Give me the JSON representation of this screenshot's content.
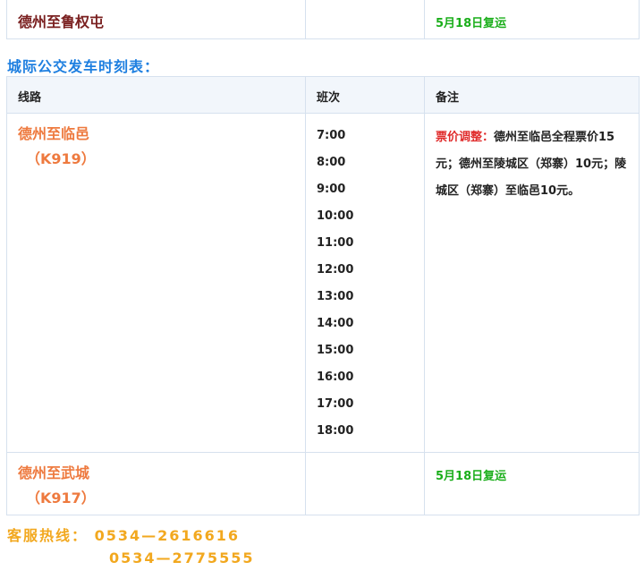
{
  "top_row": {
    "route": "德州至鲁权屯",
    "schedule": "",
    "note": "5月18日复运"
  },
  "section_heading": "城际公交发车时刻表：",
  "table": {
    "headers": {
      "route": "线路",
      "schedule": "班次",
      "note": "备注"
    },
    "row1": {
      "route_name": "德州至临邑",
      "route_code": "（K919）",
      "times": [
        "7:00",
        "8:00",
        "9:00",
        "10:00",
        "11:00",
        "12:00",
        "13:00",
        "14:00",
        "15:00",
        "16:00",
        "17:00",
        "18:00"
      ],
      "note_label": "票价调整：",
      "note_text": "德州至临邑全程票价15元；德州至陵城区（郑寨）10元；陵城区（郑寨）至临邑10元。"
    },
    "row2": {
      "route_name": "德州至武城",
      "route_code": "（K917）",
      "note": "5月18日复运"
    }
  },
  "hotline": {
    "label": "客服热线：",
    "phone1": "0534—2616616",
    "phone2": "0534—2775555"
  },
  "colors": {
    "heading_blue": "#1e7fe0",
    "route_orange": "#ee7a3f",
    "route_dark": "#7a2020",
    "status_green": "#1aae1a",
    "price_red": "#e02b2b",
    "hotline_yellow": "#f2a81f"
  }
}
